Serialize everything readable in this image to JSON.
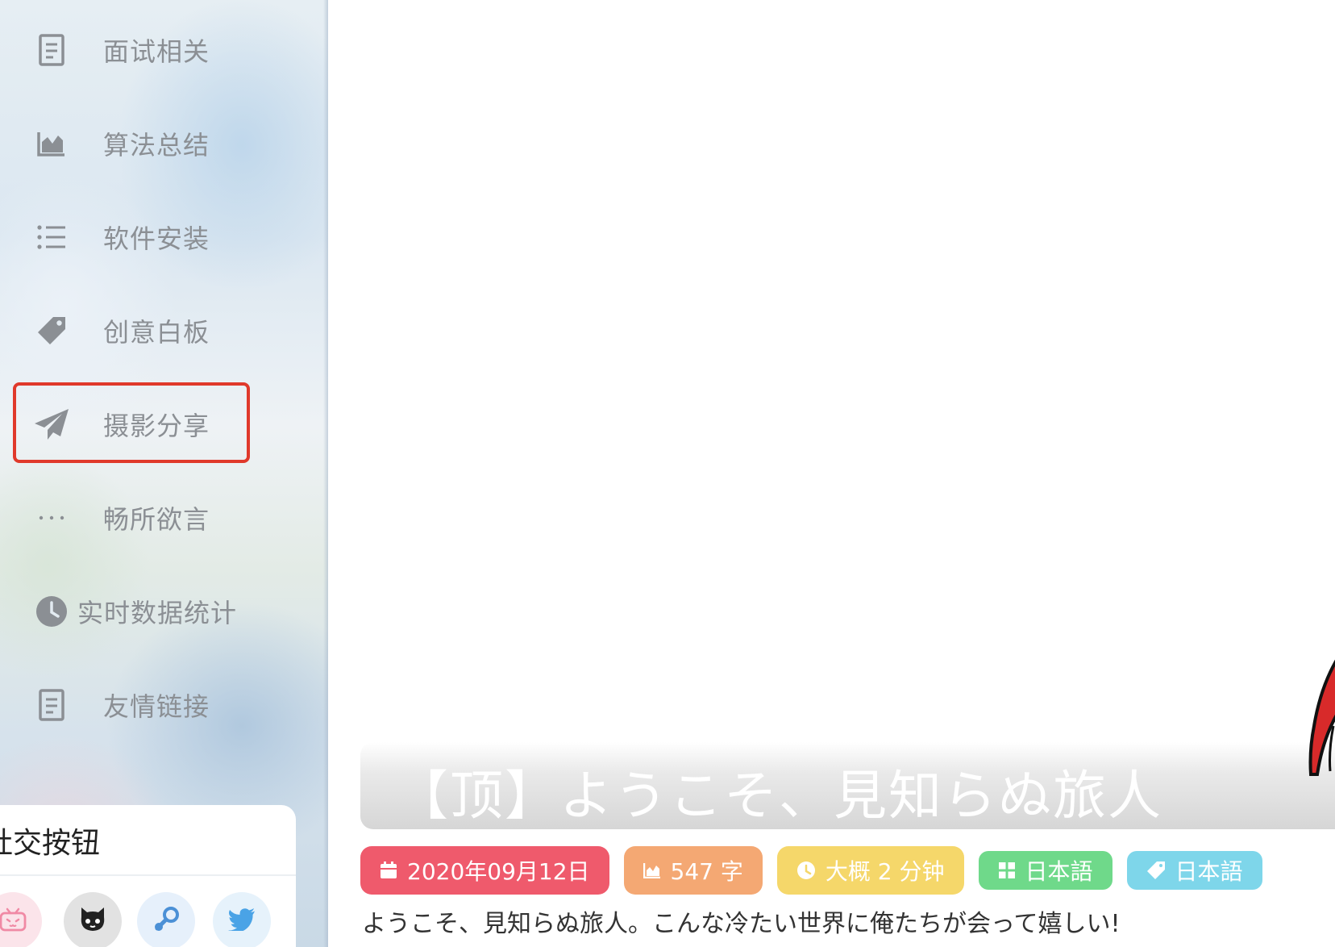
{
  "sidebar": {
    "items": [
      {
        "label": "面试相关",
        "icon": "document-icon"
      },
      {
        "label": "算法总结",
        "icon": "area-chart-icon"
      },
      {
        "label": "软件安装",
        "icon": "list-icon"
      },
      {
        "label": "创意白板",
        "icon": "tag-icon"
      },
      {
        "label": "摄影分享",
        "icon": "paper-plane-icon",
        "highlighted": true
      },
      {
        "label": "畅所欲言",
        "icon": "ellipsis-icon"
      },
      {
        "label": "实时数据统计",
        "icon": "clock-icon"
      },
      {
        "label": "友情链接",
        "icon": "document-icon"
      }
    ],
    "social": {
      "title": "社交按钮",
      "buttons": [
        {
          "name": "bilibili",
          "icon": "bilibili-icon",
          "bg": "#fbe4ea"
        },
        {
          "name": "github",
          "icon": "github-icon",
          "bg": "#e2e2e2"
        },
        {
          "name": "steam",
          "icon": "steam-icon",
          "bg": "#e6f0fb"
        },
        {
          "name": "twitter",
          "icon": "twitter-icon",
          "bg": "#e6f2fb"
        }
      ]
    }
  },
  "post": {
    "title": "【顶】ようこそ、見知らぬ旅人",
    "meta": {
      "date": "2020年09月12日",
      "words": "547 字",
      "reading_time": "大概 2 分钟",
      "category": "日本語",
      "tag": "日本語"
    },
    "excerpt": "ようこそ、見知らぬ旅人。こんな冷たい世界に俺たちが会って嬉しい!"
  },
  "colors": {
    "date_badge": "#ef5a6c",
    "words_badge": "#f4a873",
    "time_badge": "#f5d76a",
    "category_badge": "#6fd98a",
    "tag_badge": "#7ed6ea",
    "highlight_border": "#e0392b",
    "nav_text": "#8b8f94"
  }
}
